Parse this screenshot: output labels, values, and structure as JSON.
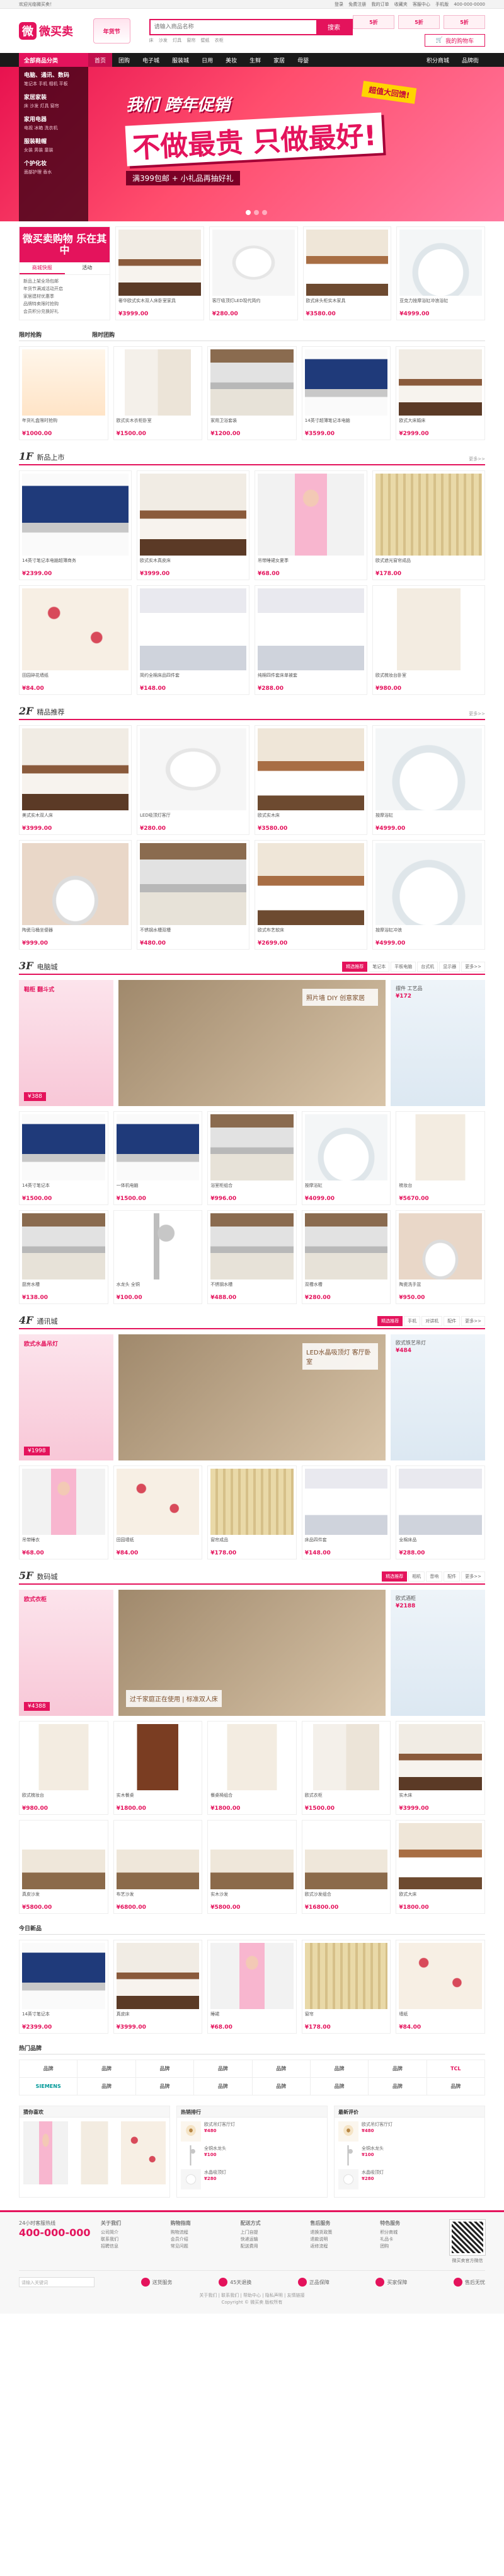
{
  "topbar": {
    "left": "欢迎光临微买卖！",
    "links": [
      "登录",
      "免费注册",
      "我的订单",
      "收藏夹",
      "客服中心",
      "手机版"
    ],
    "phone": "400-000-0000"
  },
  "header": {
    "logo_mark": "微",
    "logo_text": "微买卖",
    "badge": "年货节",
    "search_placeholder": "请输入商品名称",
    "search_button": "搜索",
    "hot_words": [
      "床",
      "沙发",
      "灯具",
      "窗帘",
      "壁纸",
      "衣柜"
    ],
    "ads": [
      "5折",
      "5折",
      "5折"
    ],
    "cart": "我的购物车"
  },
  "nav": {
    "category": "全部商品分类",
    "items": [
      "首页",
      "团购",
      "电子城",
      "服装城",
      "日用",
      "美妆",
      "生鲜",
      "家居",
      "母婴"
    ],
    "right": [
      "积分商城",
      "品牌街"
    ]
  },
  "category_menu": [
    {
      "title": "电脑、通讯、数码",
      "sub": "笔记本 手机 相机 平板"
    },
    {
      "title": "家居家装",
      "sub": "床 沙发 灯具 窗帘"
    },
    {
      "title": "家用电器",
      "sub": "电视 冰箱 洗衣机"
    },
    {
      "title": "服装鞋帽",
      "sub": "女装 男装 童装"
    },
    {
      "title": "个护化妆",
      "sub": "面部护理 香水"
    }
  ],
  "banner": {
    "line1": "我们 跨年促销",
    "line2": "不做最贵 只做最好!",
    "line3": "满399包邮 + 小礼品再抽好礼",
    "tag": "超值大回馈!"
  },
  "promo": {
    "title": "微买卖购物 乐在其中",
    "tabs": [
      "商城快报",
      "活动"
    ],
    "news": [
      "新品上架全场包邮",
      "年货节满减活动开启",
      "家居建材优惠季",
      "品牌特卖限时抢购",
      "会员积分兑换好礼"
    ]
  },
  "promo_products": [
    {
      "name": "奢华欧式实木双人床卧室家具",
      "price": "¥3999.00",
      "img": "p-bed"
    },
    {
      "name": "客厅吸顶灯LED现代简约",
      "price": "¥280.00",
      "img": "p-light"
    },
    {
      "name": "欧式床头柜实木家具",
      "price": "¥3580.00",
      "img": "p-bed2"
    },
    {
      "name": "亚克力按摩浴缸冲浪浴缸",
      "price": "¥4999.00",
      "img": "p-bath"
    }
  ],
  "group_title": "限时抢购",
  "group_sub": "限时团购",
  "group_products": [
    {
      "name": "年货礼盒限时抢购",
      "price": "¥1000.00",
      "img": "p-gift"
    },
    {
      "name": "欧式实木衣柜卧室",
      "price": "¥1500.00",
      "img": "p-wardrobe"
    },
    {
      "name": "家用卫浴套装",
      "price": "¥1200.00",
      "img": "p-sink"
    },
    {
      "name": "14英寸超薄笔记本电脑",
      "price": "¥3599.00",
      "img": "p-laptop"
    },
    {
      "name": "欧式大床婚床",
      "price": "¥2999.00",
      "img": "p-bed"
    }
  ],
  "floors": [
    {
      "num": "1F",
      "title": "新品上市",
      "more": "更多>>",
      "rows": [
        [
          {
            "name": "14英寸笔记本电脑超薄商务",
            "price": "¥2399.00",
            "img": "p-laptop"
          },
          {
            "name": "欧式实木真皮床",
            "price": "¥3999.00",
            "img": "p-bed"
          },
          {
            "name": "吊带睡裙女夏季",
            "price": "¥68.00",
            "img": "p-girl"
          },
          {
            "name": "欧式遮光窗帘成品",
            "price": "¥178.00",
            "img": "p-curtain"
          }
        ],
        [
          {
            "name": "田园碎花墙纸",
            "price": "¥84.00",
            "img": "p-wallpaper"
          },
          {
            "name": "简约全棉床品四件套",
            "price": "¥148.00",
            "img": "p-bedding"
          },
          {
            "name": "纯棉四件套床单被套",
            "price": "¥288.00",
            "img": "p-bedding"
          },
          {
            "name": "欧式梳妆台卧室",
            "price": "¥980.00",
            "img": "p-dresser"
          }
        ]
      ]
    },
    {
      "num": "2F",
      "title": "精品推荐",
      "more": "更多>>",
      "rows": [
        [
          {
            "name": "美式实木双人床",
            "price": "¥3999.00",
            "img": "p-bed"
          },
          {
            "name": "LED吸顶灯客厅",
            "price": "¥280.00",
            "img": "p-light"
          },
          {
            "name": "欧式实木床",
            "price": "¥3580.00",
            "img": "p-bed2"
          },
          {
            "name": "按摩浴缸",
            "price": "¥4999.00",
            "img": "p-bath"
          }
        ],
        [
          {
            "name": "陶瓷马桶坐便器",
            "price": "¥999.00",
            "img": "p-toilet"
          },
          {
            "name": "不锈钢水槽双槽",
            "price": "¥480.00",
            "img": "p-sink"
          },
          {
            "name": "欧式布艺软床",
            "price": "¥2699.00",
            "img": "p-bed2"
          },
          {
            "name": "按摩浴缸冲浪",
            "price": "¥4999.00",
            "img": "p-bath"
          }
        ]
      ]
    },
    {
      "num": "3F",
      "title": "电脑城",
      "tabs": [
        "精选推荐",
        "笔记本",
        "平板电脑",
        "台式机",
        "显示器",
        "更多>>"
      ],
      "feature": {
        "left_title": "鞋柜 翻斗式",
        "left_price": "¥388",
        "mid_text": "照片墙 DIY 创意家居",
        "right_title": "摆件 工艺品",
        "right_price": "¥172"
      },
      "rows": [
        [
          {
            "name": "14英寸笔记本",
            "price": "¥1500.00",
            "img": "p-laptop"
          },
          {
            "name": "一体机电脑",
            "price": "¥1500.00",
            "img": "p-laptop"
          },
          {
            "name": "浴室柜组合",
            "price": "¥996.00",
            "img": "p-sink"
          },
          {
            "name": "按摩浴缸",
            "price": "¥4099.00",
            "img": "p-bath"
          },
          {
            "name": "梳妆台",
            "price": "¥5670.00",
            "img": "p-dresser"
          }
        ],
        [
          {
            "name": "厨房水槽",
            "price": "¥138.00",
            "img": "p-sink"
          },
          {
            "name": "水龙头 全铜",
            "price": "¥100.00",
            "img": "p-faucet"
          },
          {
            "name": "不锈钢水槽",
            "price": "¥488.00",
            "img": "p-sink"
          },
          {
            "name": "双槽水槽",
            "price": "¥280.00",
            "img": "p-sink"
          },
          {
            "name": "陶瓷洗手盆",
            "price": "¥950.00",
            "img": "p-toilet"
          }
        ]
      ]
    },
    {
      "num": "4F",
      "title": "通讯城",
      "tabs": [
        "精选推荐",
        "手机",
        "对讲机",
        "配件",
        "更多>>"
      ],
      "feature": {
        "left_title": "欧式水晶吊灯",
        "left_price": "¥1998",
        "mid_text": "LED水晶吸顶灯 客厅卧室",
        "right_title": "欧式铁艺吊灯",
        "right_price": "¥484"
      },
      "rows": [
        [
          {
            "name": "吊带睡衣",
            "price": "¥68.00",
            "img": "p-girl"
          },
          {
            "name": "田园墙纸",
            "price": "¥84.00",
            "img": "p-wallpaper"
          },
          {
            "name": "窗帘成品",
            "price": "¥178.00",
            "img": "p-curtain"
          },
          {
            "name": "床品四件套",
            "price": "¥148.00",
            "img": "p-bedding"
          },
          {
            "name": "全棉床品",
            "price": "¥288.00",
            "img": "p-bedding"
          }
        ]
      ]
    },
    {
      "num": "5F",
      "title": "数码城",
      "tabs": [
        "精选推荐",
        "相机",
        "音响",
        "配件",
        "更多>>"
      ],
      "feature": {
        "left_title": "欧式衣柜",
        "left_price": "¥4388",
        "mid_text": "过千家庭正在使用 | 标准双人床",
        "right_title": "欧式酒柜",
        "right_price": "¥2188"
      },
      "rows": [
        [
          {
            "name": "欧式梳妆台",
            "price": "¥980.00",
            "img": "p-dresser"
          },
          {
            "name": "实木餐桌",
            "price": "¥1800.00",
            "img": "p-cabinet"
          },
          {
            "name": "餐桌椅组合",
            "price": "¥1800.00",
            "img": "p-dresser"
          },
          {
            "name": "欧式衣柜",
            "price": "¥1500.00",
            "img": "p-wardrobe"
          },
          {
            "name": "实木床",
            "price": "¥3999.00",
            "img": "p-bed"
          }
        ],
        [
          {
            "name": "真皮沙发",
            "price": "¥5800.00",
            "img": "p-sofa"
          },
          {
            "name": "布艺沙发",
            "price": "¥6800.00",
            "img": "p-sofa"
          },
          {
            "name": "实木沙发",
            "price": "¥5800.00",
            "img": "p-sofa"
          },
          {
            "name": "欧式沙发组合",
            "price": "¥16800.00",
            "img": "p-sofa"
          },
          {
            "name": "欧式大床",
            "price": "¥1800.00",
            "img": "p-bed2"
          }
        ]
      ]
    }
  ],
  "today": {
    "title": "今日新品",
    "products": [
      {
        "name": "14英寸笔记本",
        "price": "¥2399.00",
        "img": "p-laptop"
      },
      {
        "name": "真皮床",
        "price": "¥3999.00",
        "img": "p-bed"
      },
      {
        "name": "睡裙",
        "price": "¥68.00",
        "img": "p-girl"
      },
      {
        "name": "窗帘",
        "price": "¥178.00",
        "img": "p-curtain"
      },
      {
        "name": "墙纸",
        "price": "¥84.00",
        "img": "p-wallpaper"
      }
    ]
  },
  "brands": {
    "title": "热门品牌",
    "items": [
      "品牌",
      "品牌",
      "品牌",
      "品牌",
      "品牌",
      "品牌",
      "品牌",
      "TCL",
      "SIEMENS",
      "品牌",
      "品牌",
      "品牌",
      "品牌",
      "品牌",
      "品牌",
      "品牌"
    ]
  },
  "bottom": {
    "col1": "猜你喜欢",
    "col2": "热销排行",
    "col3": "最新评价",
    "list": [
      {
        "name": "欧式吊灯客厅灯",
        "price": "¥480"
      },
      {
        "name": "全铜水龙头",
        "price": "¥100"
      },
      {
        "name": "水晶吸顶灯",
        "price": "¥280"
      }
    ]
  },
  "footer": {
    "hotline_title": "24小时客服热线",
    "hotline": "400-000-000",
    "cols": [
      {
        "title": "关于我们",
        "items": [
          "公司简介",
          "联系我们",
          "招聘信息"
        ]
      },
      {
        "title": "购物指南",
        "items": [
          "购物流程",
          "会员介绍",
          "常见问题"
        ]
      },
      {
        "title": "配送方式",
        "items": [
          "上门自提",
          "快递运输",
          "配送费用"
        ]
      },
      {
        "title": "售后服务",
        "items": [
          "退换货政策",
          "退款说明",
          "返修流程"
        ]
      },
      {
        "title": "特色服务",
        "items": [
          "积分商城",
          "礼品卡",
          "团购"
        ]
      }
    ],
    "qr_label": "微买卖官方微信",
    "service_search": "请输入关键词",
    "services": [
      "送货服务",
      "45天退换",
      "正品保障",
      "买家保障",
      "售后无忧"
    ],
    "copyright": [
      "关于我们 | 联系我们 | 帮助中心 | 隐私声明 | 友情链接",
      "Copyright © 微买卖 版权所有"
    ]
  }
}
